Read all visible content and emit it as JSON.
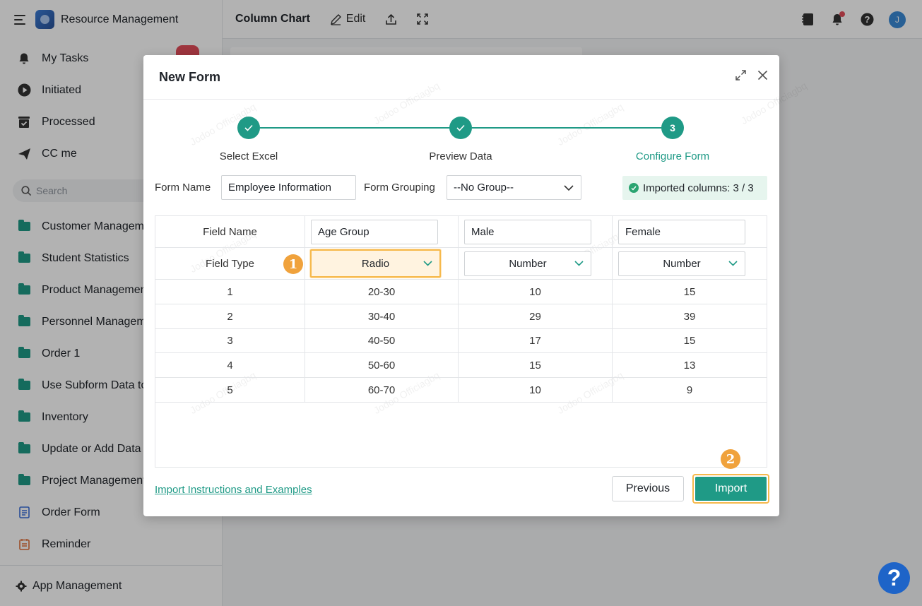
{
  "app": {
    "name": "Resource Management"
  },
  "sidebar": {
    "top_items": [
      {
        "label": "My Tasks",
        "icon": "bell-icon"
      },
      {
        "label": "Initiated",
        "icon": "play-icon"
      },
      {
        "label": "Processed",
        "icon": "inbox-check-icon"
      },
      {
        "label": "CC me",
        "icon": "send-icon"
      }
    ],
    "search_placeholder": "Search",
    "items": [
      {
        "label": "Customer Manageme",
        "icon": "folder-icon"
      },
      {
        "label": "Student Statistics",
        "icon": "folder-icon"
      },
      {
        "label": "Product Managemen",
        "icon": "folder-icon"
      },
      {
        "label": "Personnel Manageme",
        "icon": "folder-icon"
      },
      {
        "label": "Order 1",
        "icon": "folder-icon"
      },
      {
        "label": "Use Subform Data to",
        "icon": "folder-icon"
      },
      {
        "label": "Inventory",
        "icon": "folder-icon"
      },
      {
        "label": "Update or Add Data",
        "icon": "folder-icon"
      },
      {
        "label": "Project Management",
        "icon": "folder-icon"
      },
      {
        "label": "Order Form",
        "icon": "form-icon"
      },
      {
        "label": "Reminder",
        "icon": "calendar-icon"
      }
    ],
    "app_management": "App Management"
  },
  "header": {
    "title": "Column Chart",
    "edit_label": "Edit",
    "avatar_initial": "J"
  },
  "modal": {
    "title": "New Form",
    "steps": [
      {
        "label": "Select Excel",
        "state": "done"
      },
      {
        "label": "Preview Data",
        "state": "done"
      },
      {
        "label": "Configure Form",
        "state": "active",
        "number": "3"
      }
    ],
    "form_name_label": "Form Name",
    "form_name_value": "Employee Information",
    "form_grouping_label": "Form Grouping",
    "form_grouping_value": "--No Group--",
    "imported_columns": "Imported columns: 3 / 3",
    "grid": {
      "field_name_label": "Field Name",
      "field_type_label": "Field Type",
      "columns": [
        {
          "name": "Age Group",
          "type": "Radio"
        },
        {
          "name": "Male",
          "type": "Number"
        },
        {
          "name": "Female",
          "type": "Number"
        }
      ],
      "rows": [
        [
          "1",
          "20-30",
          "10",
          "15"
        ],
        [
          "2",
          "30-40",
          "29",
          "39"
        ],
        [
          "3",
          "40-50",
          "17",
          "15"
        ],
        [
          "4",
          "50-60",
          "15",
          "13"
        ],
        [
          "5",
          "60-70",
          "10",
          "9"
        ]
      ]
    },
    "markers": [
      "1",
      "2"
    ],
    "instructions_link": "Import Instructions and Examples",
    "previous_label": "Previous",
    "import_label": "Import"
  },
  "watermark": "Jodoo Officiagbq",
  "colors": {
    "accent": "#1f9a86",
    "highlight": "#f6b94c",
    "marker": "#f0a23c"
  }
}
